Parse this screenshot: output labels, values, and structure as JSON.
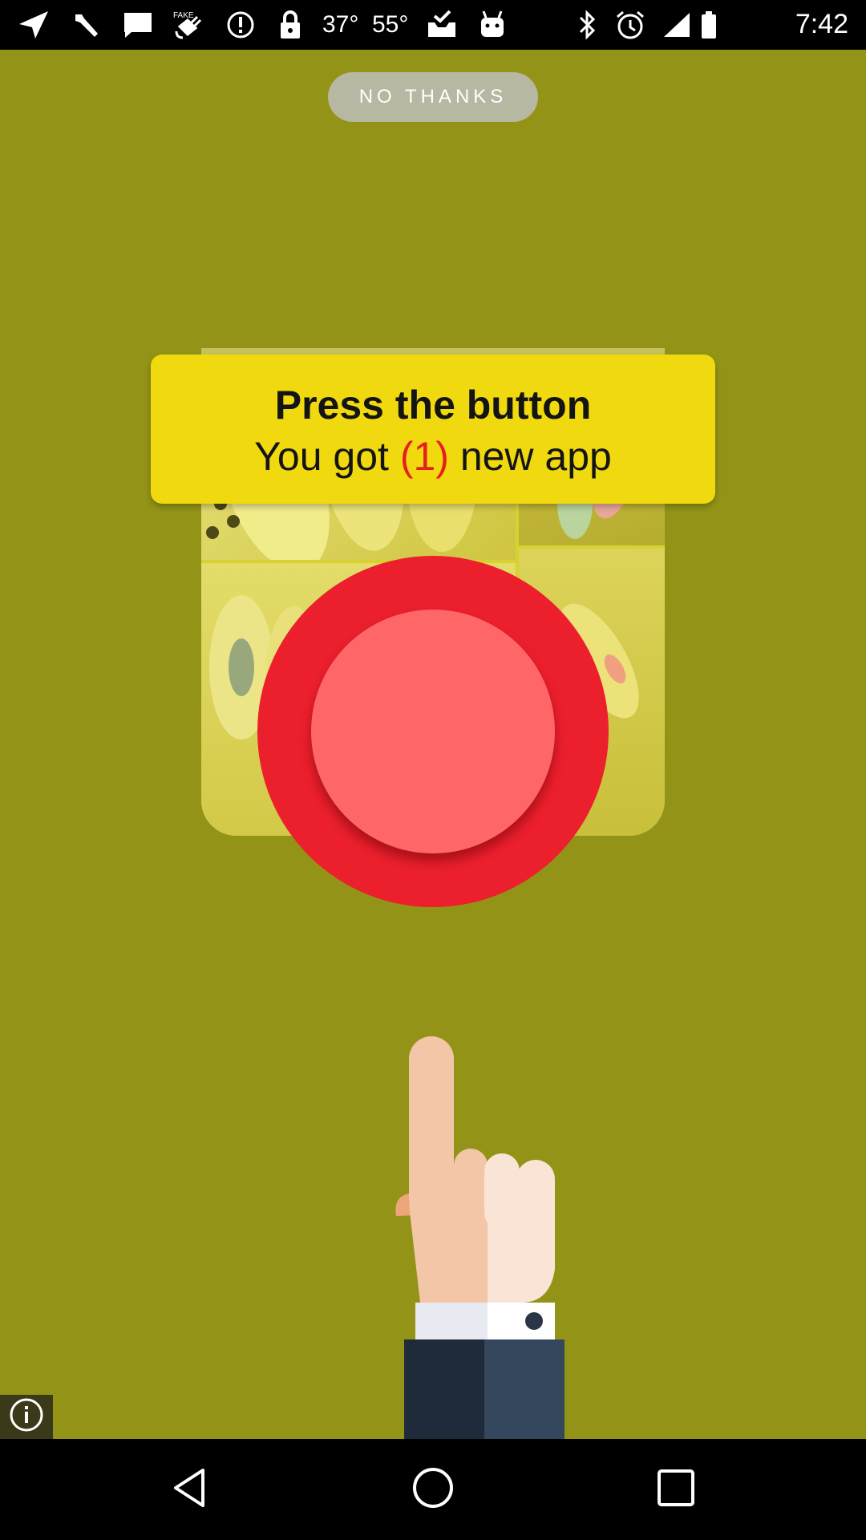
{
  "status_bar": {
    "temperature_1": "37°",
    "temperature_2": "55°",
    "time": "7:42",
    "icons": [
      "send-icon",
      "wrench-icon",
      "chat-icon",
      "fake-gps-icon",
      "alert-icon",
      "lock-icon",
      "temperature-icon",
      "inbox-icon",
      "android-icon",
      "bluetooth-icon",
      "alarm-icon",
      "signal-icon",
      "battery-icon"
    ]
  },
  "dialog": {
    "no_thanks_label": "NO THANKS",
    "title": "Press the button",
    "line_prefix": "You got ",
    "count": "(1)",
    "line_suffix": " new app"
  },
  "colors": {
    "background": "#939417",
    "banner": "#f0d90e",
    "button_outer": "#ec1f2d",
    "button_inner": "#ff6668",
    "count_text": "#e61e22"
  },
  "nav_bar": {
    "icons": [
      "back-icon",
      "home-icon",
      "recents-icon"
    ]
  }
}
